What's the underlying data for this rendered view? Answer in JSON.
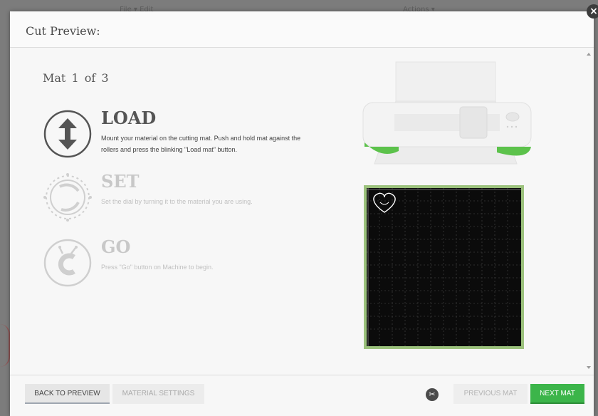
{
  "background": {
    "menu_left": "File ▾   Edit",
    "menu_right": "Actions ▾"
  },
  "dialog": {
    "title": "Cut Preview:",
    "close_glyph": "×"
  },
  "mat_counter": {
    "label": "Mat",
    "current": "1",
    "of": "of",
    "total": "3"
  },
  "steps": [
    {
      "title": "LOAD",
      "icon": "load-arrows-icon",
      "state": "active",
      "description": "Mount your material on the cutting mat. Push and hold mat against the rollers and press the blinking \"Load mat\" button."
    },
    {
      "title": "SET",
      "icon": "dial-icon",
      "state": "inactive",
      "description": "Set the dial by turning it to the material you are using."
    },
    {
      "title": "GO",
      "icon": "go-button-icon",
      "state": "inactive",
      "description": "Press \"Go\" button on Machine to begin."
    }
  ],
  "preview": {
    "machine_icon": "cutting-machine-illustration",
    "mat_icon": "cutting-mat-preview",
    "design_icon": "heart-design-icon",
    "mat_color": "#9cc27d",
    "machine_accent": "#5cc24b"
  },
  "footer": {
    "back_label": "BACK TO PREVIEW",
    "material_label": "MATERIAL SETTINGS",
    "scissors_icon": "scissors-icon",
    "prev_label": "PREVIOUS MAT",
    "next_label": "NEXT MAT",
    "next_color": "#3cb54a"
  }
}
